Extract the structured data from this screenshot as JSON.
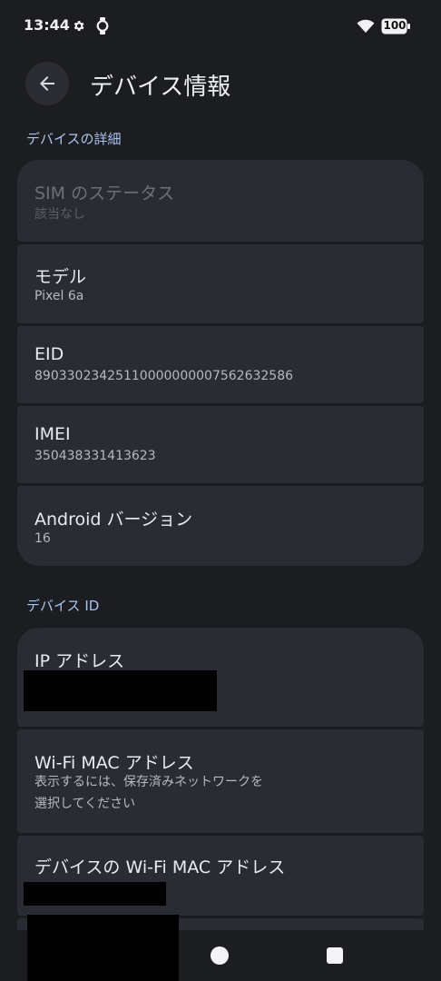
{
  "status_bar": {
    "time": "13:44",
    "battery": "100",
    "icons": [
      "gear-icon",
      "watch-icon",
      "wifi-icon",
      "battery-icon"
    ]
  },
  "header": {
    "title": "デバイス情報",
    "back_icon": "arrow-left-icon"
  },
  "sections": {
    "details": {
      "header": "デバイスの詳細",
      "items": [
        {
          "title": "SIM のステータス",
          "value": "該当なし"
        },
        {
          "title": "モデル",
          "value": "Pixel 6a"
        },
        {
          "title": "EID",
          "value": "89033023425110000000007562632586"
        },
        {
          "title": "IMEI",
          "value": "350438331413623"
        },
        {
          "title": "Android バージョン",
          "value": "16"
        }
      ]
    },
    "ids": {
      "header": "デバイス ID",
      "items": [
        {
          "title": "IP アドレス"
        },
        {
          "title": "Wi-Fi MAC アドレス",
          "value_line1": "表示するには、保存済みネットワークを",
          "value_line2": "選択してください"
        },
        {
          "title": "デバイスの Wi-Fi MAC アドレス"
        }
      ]
    }
  },
  "colors": {
    "background": "#1c1d21",
    "card": "#2a2c33",
    "accent": "#a9c4f2"
  }
}
